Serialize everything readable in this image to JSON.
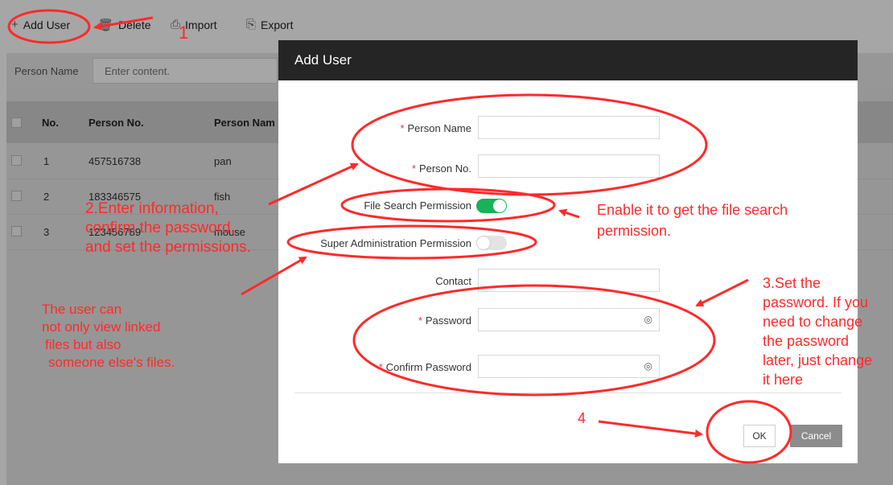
{
  "toolbar": {
    "add_user": "Add User",
    "delete": "Delete",
    "import": "Import",
    "export": "Export"
  },
  "filter": {
    "label": "Person Name",
    "placeholder": "Enter content."
  },
  "table": {
    "columns": [
      "No.",
      "Person No.",
      "Person Nam"
    ],
    "rows": [
      {
        "no": "1",
        "person_no": "457516738",
        "name": "pan"
      },
      {
        "no": "2",
        "person_no": "183346575",
        "name": "fish"
      },
      {
        "no": "3",
        "person_no": "123456789",
        "name": "mouse"
      }
    ]
  },
  "modal": {
    "title": "Add User",
    "required_mark": "*",
    "fields": {
      "person_name": "Person Name",
      "person_no": "Person No.",
      "file_search": "File Search Permission",
      "super_admin": "Super Administration Permission",
      "contact": "Contact",
      "password": "Password",
      "confirm_password": "Confirm Password"
    },
    "file_search_enabled": true,
    "super_admin_enabled": false,
    "ok": "OK",
    "cancel": "Cancel"
  },
  "annotations": {
    "step1": "1",
    "step2_line1": "2.Enter information,",
    "step2_line2": "confirm the password,",
    "step2_line3": "and set the permissions.",
    "note_line1": "The user can",
    "note_line2": "not only view linked",
    "note_line3": "files but also",
    "note_line4": "someone else's files.",
    "file_search_line1": "Enable it to get the file search",
    "file_search_line2": "permission.",
    "step3_line1": "3.Set the",
    "step3_line2": "password. If you",
    "step3_line3": "need to change",
    "step3_line4": "the password",
    "step3_line5": "later, just change",
    "step3_line6": "it here",
    "step4": "4"
  },
  "colors": {
    "annotation": "#ff2a2a",
    "toggle_on": "#18b25a",
    "modal_header": "#252525"
  },
  "icons": {
    "add": "plus-icon",
    "delete": "trash-icon",
    "import": "import-icon",
    "export": "export-icon",
    "password_visibility": "eye-slash-icon"
  }
}
